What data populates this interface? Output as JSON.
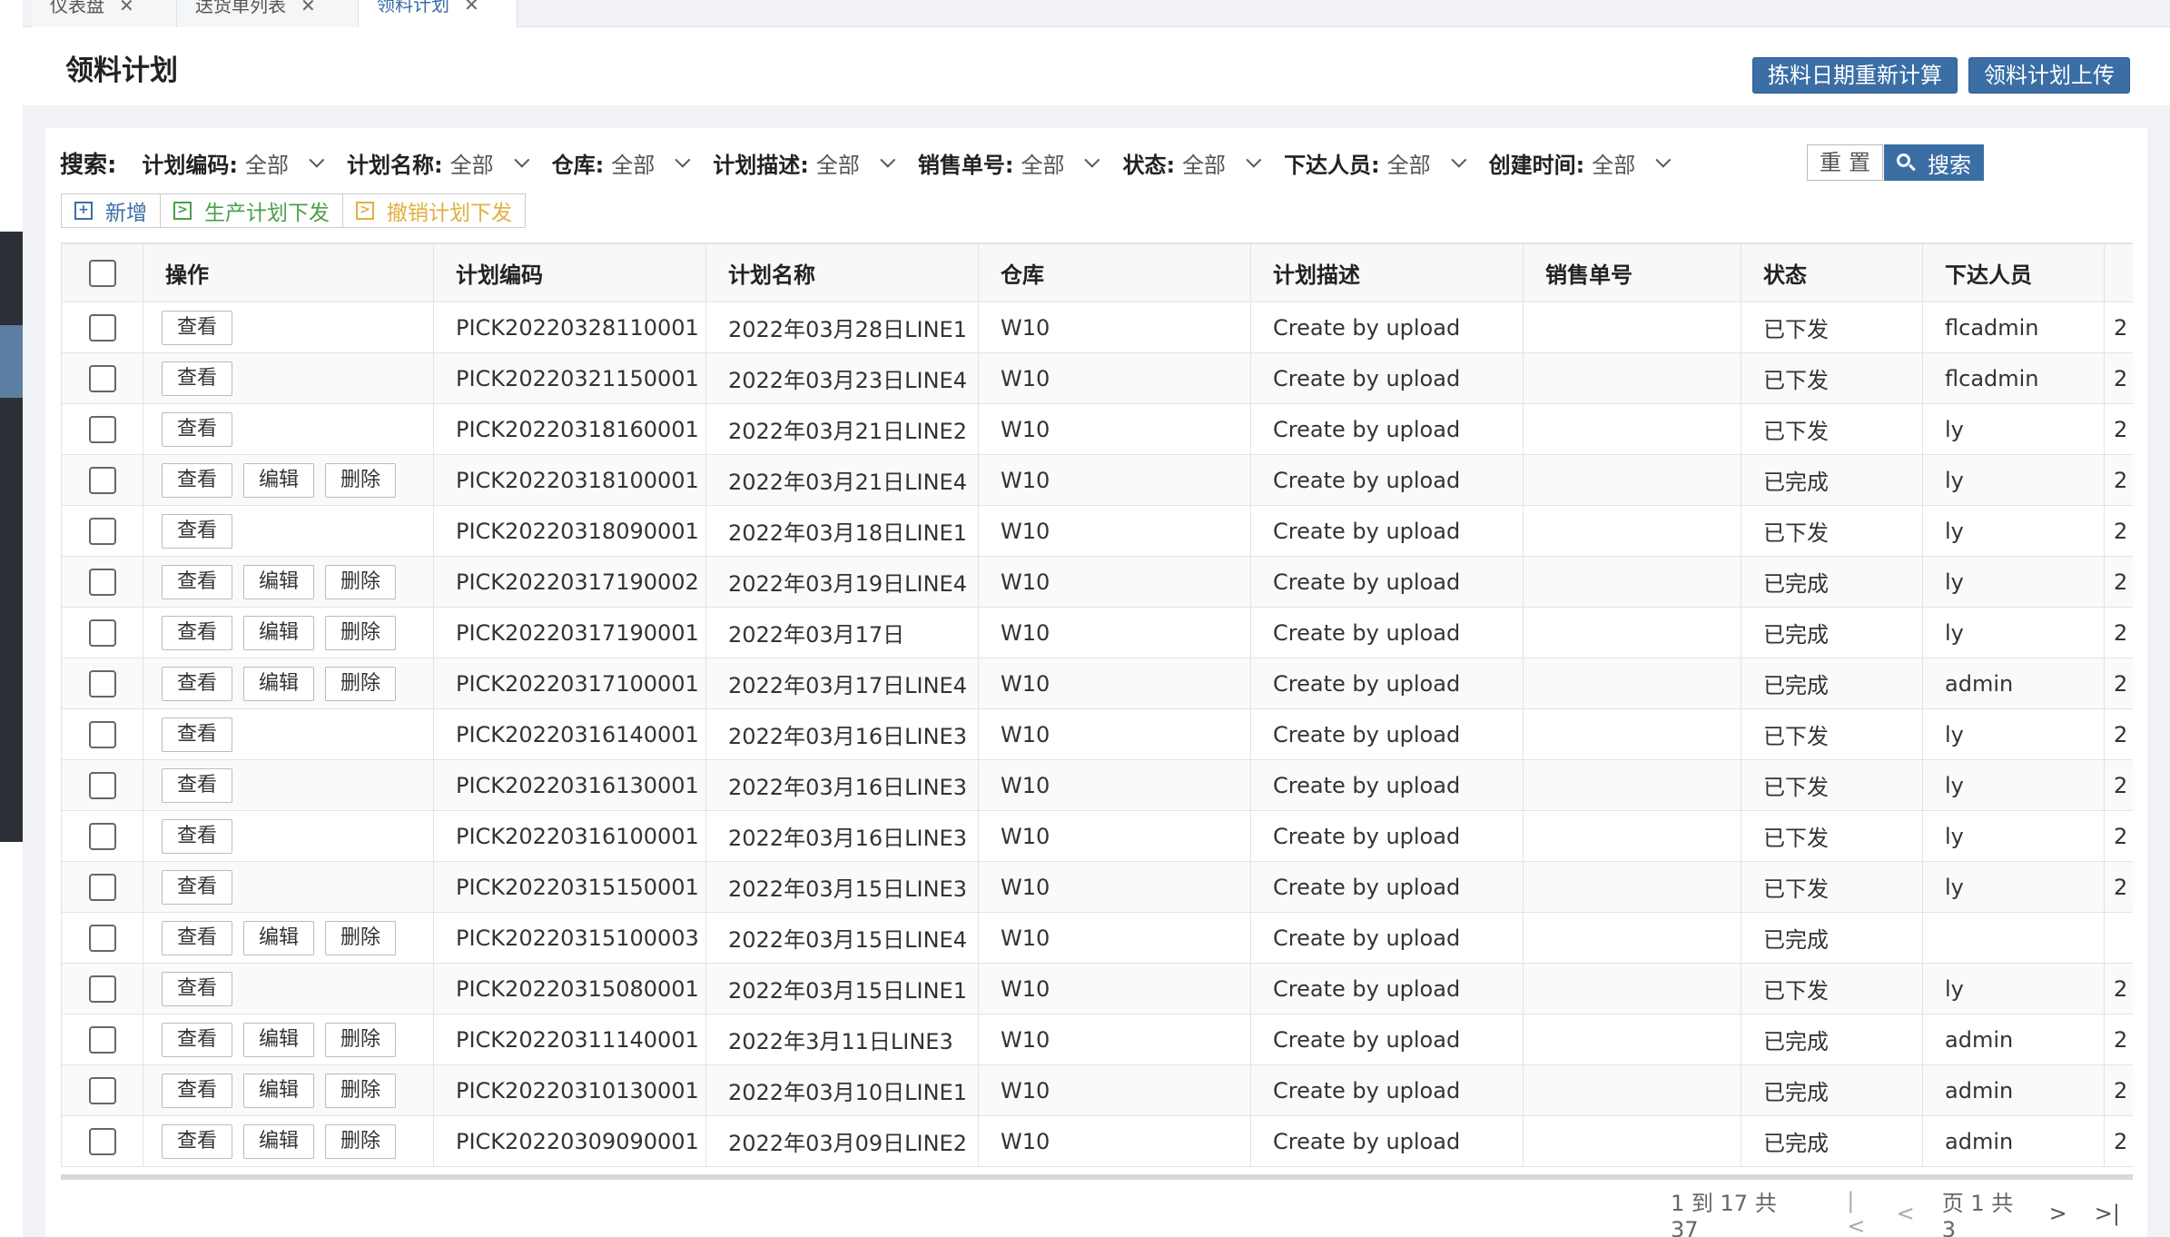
{
  "tabs": [
    {
      "label": "仪表盘",
      "active": false
    },
    {
      "label": "送货单列表",
      "active": false
    },
    {
      "label": "领料计划",
      "active": true
    }
  ],
  "page": {
    "title": "领料计划"
  },
  "header_buttons": {
    "recalc": "拣料日期重新计算",
    "upload": "领料计划上传"
  },
  "search": {
    "label": "搜索:",
    "filters": [
      {
        "name": "计划编码:",
        "value": "全部"
      },
      {
        "name": "计划名称:",
        "value": "全部"
      },
      {
        "name": "仓库:",
        "value": "全部"
      },
      {
        "name": "计划描述:",
        "value": "全部"
      },
      {
        "name": "销售单号:",
        "value": "全部"
      },
      {
        "name": "状态:",
        "value": "全部"
      },
      {
        "name": "下达人员:",
        "value": "全部"
      },
      {
        "name": "创建时间:",
        "value": "全部"
      }
    ],
    "reset_label": "重置",
    "search_label": "搜索"
  },
  "actions": {
    "new": "新增",
    "issue": "生产计划下发",
    "cancel": "撤销计划下发"
  },
  "table": {
    "columns": [
      "操作",
      "计划编码",
      "计划名称",
      "仓库",
      "计划描述",
      "销售单号",
      "状态",
      "下达人员",
      ""
    ],
    "op_labels": {
      "view": "查看",
      "edit": "编辑",
      "delete": "删除"
    },
    "rows": [
      {
        "code": "PICK20220328110001",
        "name": "2022年03月28日LINE1",
        "wh": "W10",
        "desc": "Create by upload",
        "so": "",
        "status": "已下发",
        "user": "flcadmin",
        "extra": "2",
        "editable": false
      },
      {
        "code": "PICK20220321150001",
        "name": "2022年03月23日LINE4",
        "wh": "W10",
        "desc": "Create by upload",
        "so": "",
        "status": "已下发",
        "user": "flcadmin",
        "extra": "2",
        "editable": false
      },
      {
        "code": "PICK20220318160001",
        "name": "2022年03月21日LINE2",
        "wh": "W10",
        "desc": "Create by upload",
        "so": "",
        "status": "已下发",
        "user": "ly",
        "extra": "2",
        "editable": false
      },
      {
        "code": "PICK20220318100001",
        "name": "2022年03月21日LINE4",
        "wh": "W10",
        "desc": "Create by upload",
        "so": "",
        "status": "已完成",
        "user": "ly",
        "extra": "2",
        "editable": true
      },
      {
        "code": "PICK20220318090001",
        "name": "2022年03月18日LINE1",
        "wh": "W10",
        "desc": "Create by upload",
        "so": "",
        "status": "已下发",
        "user": "ly",
        "extra": "2",
        "editable": false
      },
      {
        "code": "PICK20220317190002",
        "name": "2022年03月19日LINE4",
        "wh": "W10",
        "desc": "Create by upload",
        "so": "",
        "status": "已完成",
        "user": "ly",
        "extra": "2",
        "editable": true
      },
      {
        "code": "PICK20220317190001",
        "name": "2022年03月17日",
        "wh": "W10",
        "desc": "Create by upload",
        "so": "",
        "status": "已完成",
        "user": "ly",
        "extra": "2",
        "editable": true
      },
      {
        "code": "PICK20220317100001",
        "name": "2022年03月17日LINE4",
        "wh": "W10",
        "desc": "Create by upload",
        "so": "",
        "status": "已完成",
        "user": "admin",
        "extra": "2",
        "editable": true
      },
      {
        "code": "PICK20220316140001",
        "name": "2022年03月16日LINE3",
        "wh": "W10",
        "desc": "Create by upload",
        "so": "",
        "status": "已下发",
        "user": "ly",
        "extra": "2",
        "editable": false
      },
      {
        "code": "PICK20220316130001",
        "name": "2022年03月16日LINE3",
        "wh": "W10",
        "desc": "Create by upload",
        "so": "",
        "status": "已下发",
        "user": "ly",
        "extra": "2",
        "editable": false
      },
      {
        "code": "PICK20220316100001",
        "name": "2022年03月16日LINE3",
        "wh": "W10",
        "desc": "Create by upload",
        "so": "",
        "status": "已下发",
        "user": "ly",
        "extra": "2",
        "editable": false
      },
      {
        "code": "PICK20220315150001",
        "name": "2022年03月15日LINE3",
        "wh": "W10",
        "desc": "Create by upload",
        "so": "",
        "status": "已下发",
        "user": "ly",
        "extra": "2",
        "editable": false
      },
      {
        "code": "PICK20220315100003",
        "name": "2022年03月15日LINE4",
        "wh": "W10",
        "desc": "Create by upload",
        "so": "",
        "status": "已完成",
        "user": "",
        "extra": "",
        "editable": true
      },
      {
        "code": "PICK20220315080001",
        "name": "2022年03月15日LINE1",
        "wh": "W10",
        "desc": "Create by upload",
        "so": "",
        "status": "已下发",
        "user": "ly",
        "extra": "2",
        "editable": false
      },
      {
        "code": "PICK20220311140001",
        "name": "2022年3月11日LINE3",
        "wh": "W10",
        "desc": "Create by upload",
        "so": "",
        "status": "已完成",
        "user": "admin",
        "extra": "2",
        "editable": true
      },
      {
        "code": "PICK20220310130001",
        "name": "2022年03月10日LINE1",
        "wh": "W10",
        "desc": "Create by upload",
        "so": "",
        "status": "已完成",
        "user": "admin",
        "extra": "2",
        "editable": true
      },
      {
        "code": "PICK20220309090001",
        "name": "2022年03月09日LINE2",
        "wh": "W10",
        "desc": "Create by upload",
        "so": "",
        "status": "已完成",
        "user": "admin",
        "extra": "2",
        "editable": true
      }
    ]
  },
  "pager": {
    "info": "1 到 17 共 37",
    "page_text": "页 1 共 3"
  }
}
